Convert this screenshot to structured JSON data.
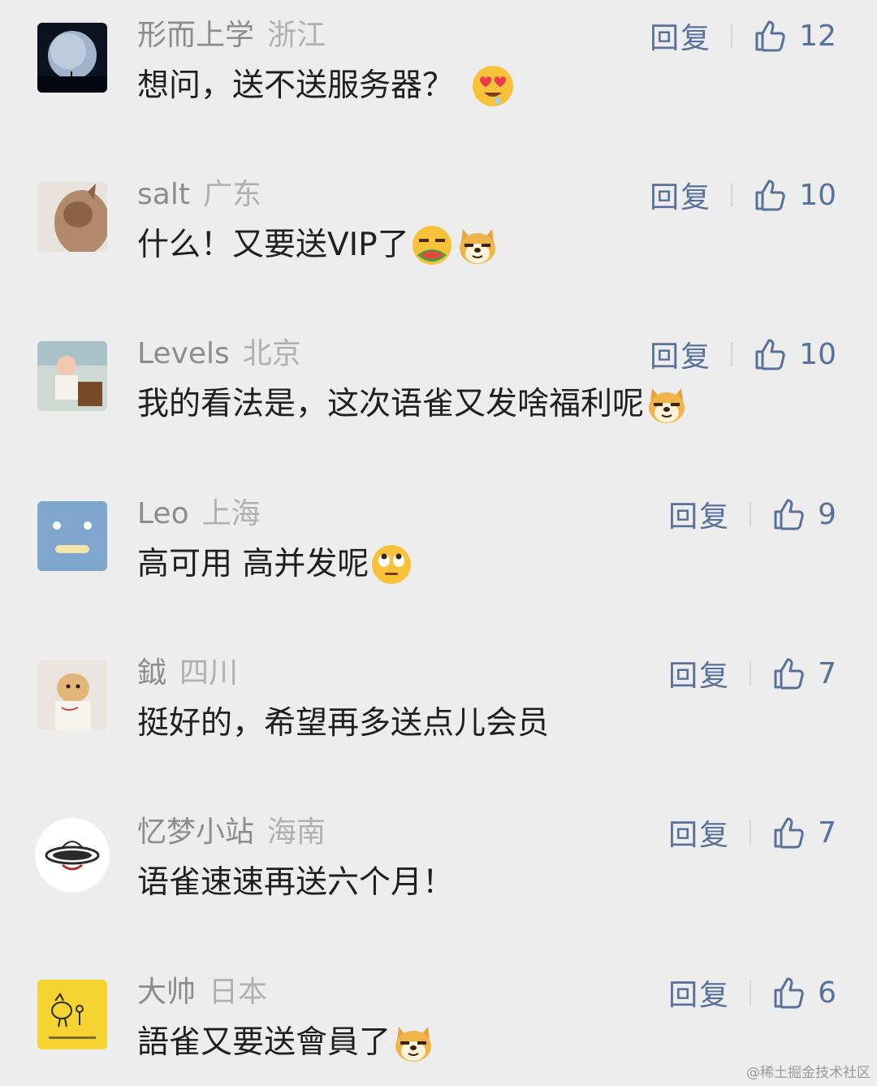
{
  "reply_label": "回复",
  "comments": [
    {
      "username": "形而上学",
      "location": "浙江",
      "text": "想问，送不送服务器？",
      "emojis": [
        "heart-eyes-emoji"
      ],
      "likes": "12",
      "avatar": "earth-avatar"
    },
    {
      "username": "salt",
      "location": "广东",
      "text": "什么！又要送VIP了",
      "emojis": [
        "eating-melon-emoji",
        "doge-emoji"
      ],
      "likes": "10",
      "avatar": "cat-avatar"
    },
    {
      "username": "Levels",
      "location": "北京",
      "text": "我的看法是，这次语雀又发啥福利呢",
      "emojis": [
        "doge-emoji"
      ],
      "likes": "10",
      "avatar": "child-photo-avatar"
    },
    {
      "username": "Leo",
      "location": "上海",
      "text": "高可用 高并发呢",
      "emojis": [
        "eye-roll-emoji"
      ],
      "likes": "9",
      "avatar": "blue-face-avatar"
    },
    {
      "username": "鉞",
      "location": "四川",
      "text": "挺好的，希望再多送点儿会员",
      "emojis": [],
      "likes": "7",
      "avatar": "puppy-avatar"
    },
    {
      "username": "忆梦小站",
      "location": "海南",
      "text": "语雀速速再送六个月！",
      "emojis": [],
      "likes": "7",
      "avatar": "logo-avatar"
    },
    {
      "username": "大帅",
      "location": "日本",
      "text": "語雀又要送會員了",
      "emojis": [
        "doge-emoji"
      ],
      "likes": "6",
      "avatar": "yellow-bird-avatar"
    }
  ],
  "watermark": "@稀土掘金技术社区",
  "colors": {
    "background": "#ededed",
    "link": "#58719a",
    "username": "#8c8c8c",
    "location": "#b0b0b0",
    "text": "#1f1f1f"
  }
}
